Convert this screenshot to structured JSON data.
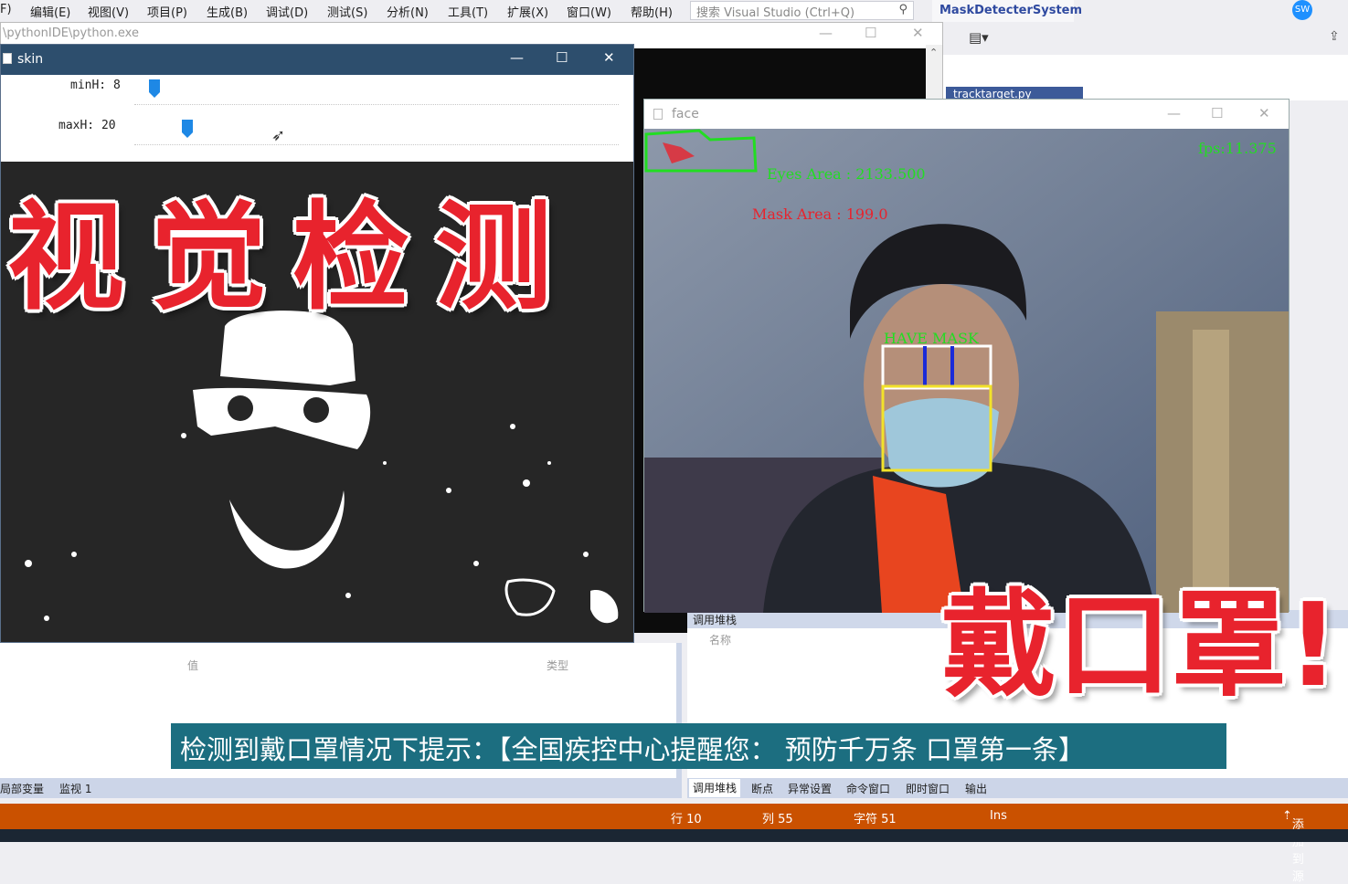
{
  "menu": {
    "items": [
      "F)",
      "编辑(E)",
      "视图(V)",
      "项目(P)",
      "生成(B)",
      "调试(D)",
      "测试(S)",
      "分析(N)",
      "工具(T)",
      "扩展(X)",
      "窗口(W)",
      "帮助(H)"
    ],
    "search_placeholder": "搜索 Visual Studio (Ctrl+Q)",
    "solution_name": "MaskDetecterSystem",
    "user_initials": "SW"
  },
  "doc_tab": "tracktarget.py",
  "console_window": {
    "title": "\\pythonIDE\\python.exe"
  },
  "skin_window": {
    "title": "skin",
    "trackbars": [
      {
        "label": "minH: 8",
        "value": 8
      },
      {
        "label": "maxH: 20",
        "value": 20
      }
    ]
  },
  "face_window": {
    "title": "face",
    "eyes_area_text": "Eyes Area : 2133.500",
    "mask_area_text": "Mask Area : 199.0",
    "fps_text": "fps:11.375",
    "status_label": "HAVE MASK"
  },
  "overlays": {
    "title": "视觉检测",
    "mask_text": "戴口罩!",
    "subtitle": "检测到戴口罩情况下提示：【全国疾控中心提醒您： 预防千万条 口罩第一条】"
  },
  "locals_panel": {
    "col_value": "值",
    "col_type": "类型",
    "tabs": [
      "局部变量",
      "监视 1"
    ]
  },
  "callstack_panel": {
    "title": "调用堆栈",
    "col_name": "名称",
    "tabs": [
      "调用堆栈",
      "断点",
      "异常设置",
      "命令窗口",
      "即时窗口",
      "输出"
    ]
  },
  "statusbar": {
    "line": "行 10",
    "col": "列 55",
    "char": "字符 51",
    "mode": "Ins",
    "source_control": "添加到源"
  },
  "colors": {
    "vs_accent": "#2f4aa0",
    "status_orange": "#ca5100",
    "overlay_red": "#e8232d",
    "subtitle_bg": "#1c6e80",
    "cv_green": "#22dd22",
    "cv_red": "#e8232d",
    "face_box": "#ffffff",
    "mask_box": "#f2e22a",
    "eye_line": "#1a2bd8"
  }
}
